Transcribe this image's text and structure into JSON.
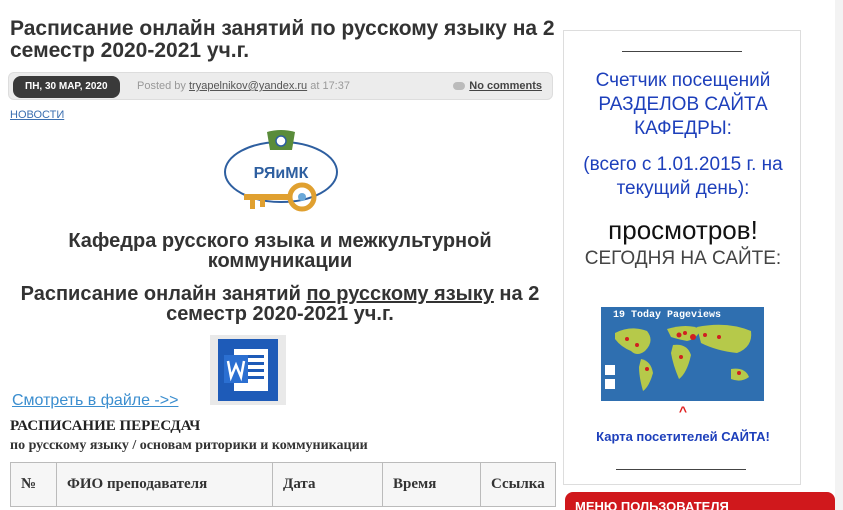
{
  "post": {
    "title": "Расписание онлайн занятий по русскому языку на 2 семестр 2020-2021 уч.г.",
    "date": "ПН, 30 МАР, 2020",
    "posted_by": "Posted by",
    "author": "tryapelnikov@yandex.ru",
    "at": "at 17:37",
    "comments": "No comments",
    "category": "НОВОСТИ"
  },
  "logo": {
    "text": "РЯиМК",
    "icon": "university-key-logo"
  },
  "content": {
    "department": "Кафедра русского языка и межкультурной коммуникации",
    "schedule_prefix": "Расписание онлайн занятий ",
    "schedule_link": "по русскому языку",
    "schedule_suffix": " на 2 семестр 2020-2021 уч.г.",
    "view_link": "Смотреть  в файле ->>",
    "file_icon": "word-document-icon",
    "retake_title": "РАСПИСАНИЕ ПЕРЕСДАЧ",
    "retake_subtitle": "по русскому языку / основам риторики и коммуникации"
  },
  "table": {
    "columns": [
      "№",
      "ФИО преподавателя",
      "Дата",
      "Время",
      "Ссылка"
    ]
  },
  "sidebar": {
    "counter_title": "Счетчик посещений РАЗДЕЛОВ САЙТА КАФЕДРЫ:",
    "since": "(всего с 1.01.2015 г. на текущий день):",
    "views": "просмотров!",
    "today_on_site": "СЕГОДНЯ НА САЙТЕ:",
    "map_widget_label": "19 Today Pageviews",
    "caret": "^",
    "map_link": "Карта посетителей САЙТА!",
    "menu_header": "МЕНЮ ПОЛЬЗОВАТЕЛЯ"
  },
  "colors": {
    "accent_blue": "#1d3fbb",
    "link_blue": "#3b8ecf",
    "menu_red": "#d0181c",
    "map_bg": "#2f6fb0"
  }
}
